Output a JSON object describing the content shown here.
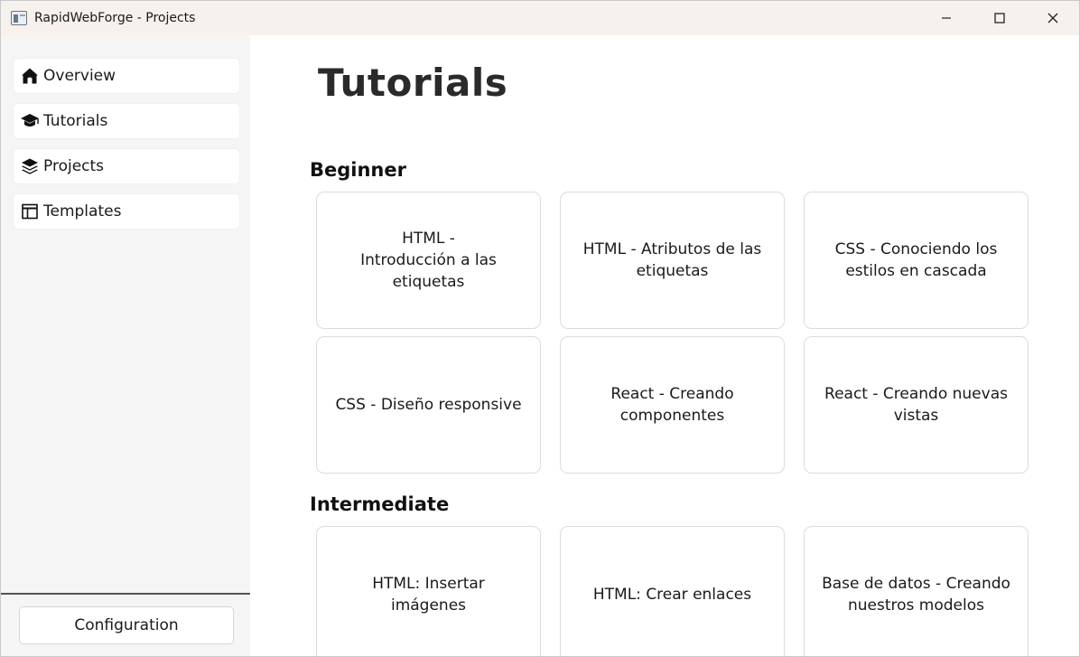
{
  "window": {
    "title": "RapidWebForge - Projects"
  },
  "sidebar": {
    "items": [
      {
        "label": "Overview",
        "icon": "home-icon"
      },
      {
        "label": "Tutorials",
        "icon": "graduation-cap-icon"
      },
      {
        "label": "Projects",
        "icon": "layers-icon"
      },
      {
        "label": "Templates",
        "icon": "layout-template-icon"
      }
    ],
    "config_label": "Configuration"
  },
  "main": {
    "title": "Tutorials",
    "sections": [
      {
        "title": "Beginner",
        "cards": [
          "HTML -\nIntroducción a las etiquetas",
          "HTML - Atributos de las etiquetas",
          "CSS - Conociendo los estilos en cascada",
          "CSS - Diseño responsive",
          "React - Creando componentes",
          "React - Creando nuevas vistas"
        ]
      },
      {
        "title": "Intermediate",
        "cards": [
          "HTML: Insertar imágenes",
          "HTML: Crear enlaces",
          "Base de datos - Creando nuestros modelos"
        ]
      }
    ]
  }
}
